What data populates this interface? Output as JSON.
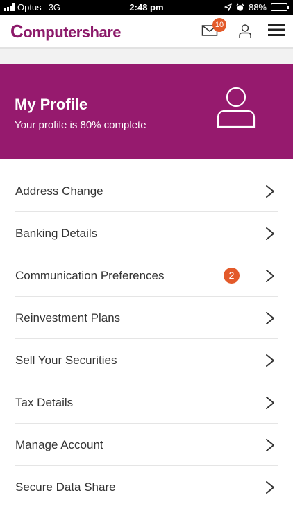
{
  "status_bar": {
    "carrier": "Optus",
    "network": "3G",
    "time": "2:48 pm",
    "battery": "88%",
    "battery_level": 0.88
  },
  "header": {
    "logo_text": "omputershare",
    "logo_initial": "C",
    "mail_badge": "10",
    "brand_color": "#961a6e",
    "badge_color": "#e35a2a"
  },
  "profile": {
    "title": "My Profile",
    "subtitle": "Your profile is 80% complete",
    "completion": 0.8
  },
  "menu": {
    "items": [
      {
        "label": "Address Change"
      },
      {
        "label": "Banking Details"
      },
      {
        "label": "Communication Preferences",
        "badge": "2"
      },
      {
        "label": "Reinvestment Plans"
      },
      {
        "label": "Sell Your Securities"
      },
      {
        "label": "Tax Details"
      },
      {
        "label": "Manage Account"
      },
      {
        "label": "Secure Data Share"
      }
    ]
  }
}
